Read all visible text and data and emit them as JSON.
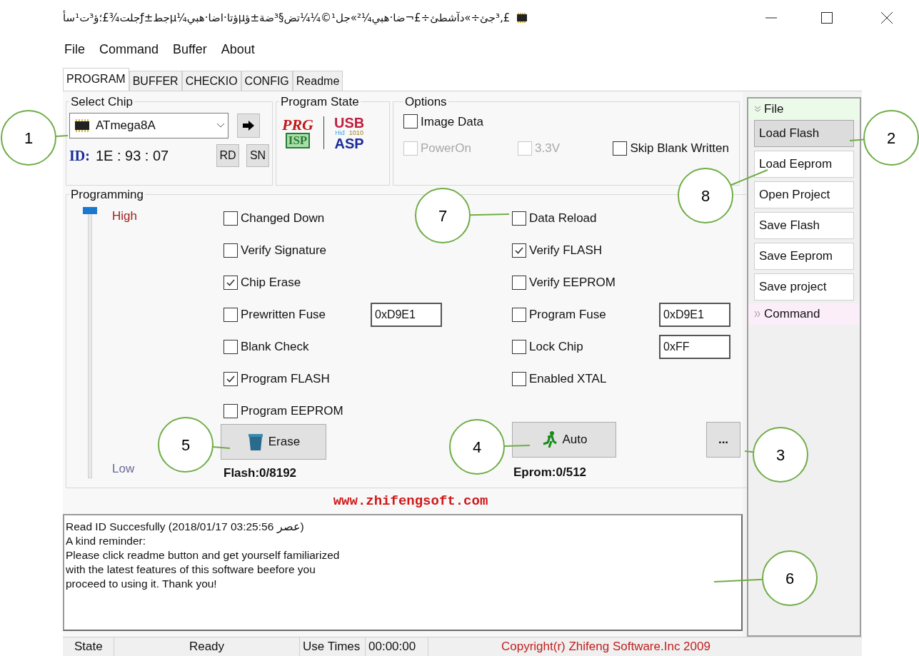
{
  "window": {
    "title": "£‚³جئ÷»دآشطئ÷£¬ضا·هبي¼²»جل¹©¼¼تض§³ضة±ؤµؤتا·اضا·هبي¼µجط±ƒجلت¾£؛ؤ³ت¹سأ"
  },
  "menu": [
    "File",
    "Command",
    "Buffer",
    "About"
  ],
  "tabs": [
    {
      "label": "PROGRAM",
      "selected": true
    },
    {
      "label": "BUFFER",
      "selected": false
    },
    {
      "label": "CHECKIO",
      "selected": false
    },
    {
      "label": "CONFIG",
      "selected": false
    },
    {
      "label": "Readme",
      "selected": false
    }
  ],
  "select_chip": {
    "title": "Select Chip",
    "chip": "ATmega8A",
    "id_label": "ID:",
    "id_value": "1E : 93 : 07",
    "buttons": [
      "RD",
      "SN"
    ]
  },
  "program_state": {
    "title": "Program State",
    "prg": "PRG",
    "isp": "ISP",
    "usb": "USB",
    "hid": "Hid",
    "bits": "1010",
    "asp": "ASP"
  },
  "options": {
    "title": "Options",
    "items": [
      {
        "label": "Image Data",
        "checked": false,
        "disabled": false
      },
      {
        "label": "PowerOn",
        "checked": false,
        "disabled": true
      },
      {
        "label": "3.3V",
        "checked": false,
        "disabled": true
      },
      {
        "label": "Skip Blank Written",
        "checked": false,
        "disabled": false
      }
    ]
  },
  "programming": {
    "title": "Programming",
    "speed": {
      "high": "High",
      "low": "Low",
      "level": 1
    },
    "left": [
      {
        "label": "Changed Down",
        "checked": false
      },
      {
        "label": "Verify Signature",
        "checked": false
      },
      {
        "label": "Chip Erase",
        "checked": true
      },
      {
        "label": "Prewritten Fuse",
        "checked": false,
        "value": "0xD9E1"
      },
      {
        "label": "Blank Check",
        "checked": false
      },
      {
        "label": "Program FLASH",
        "checked": true
      },
      {
        "label": "Program EEPROM",
        "checked": false
      }
    ],
    "right": [
      {
        "label": "Data Reload",
        "checked": false
      },
      {
        "label": "Verify FLASH",
        "checked": true
      },
      {
        "label": "Verify EEPROM",
        "checked": false
      },
      {
        "label": "Program Fuse",
        "checked": false,
        "value": "0xD9E1"
      },
      {
        "label": "Lock Chip",
        "checked": false,
        "value": "0xFF"
      },
      {
        "label": "Enabled XTAL",
        "checked": false
      }
    ],
    "erase": "Erase",
    "auto": "Auto",
    "more": "...",
    "flash_count": "Flash:0/8192",
    "eprom_count": "Eprom:0/512"
  },
  "website": "www.zhifengsoft.com",
  "log": [
    "Read ID Succesfully (2018/01/17 03:25:56 عصر)",
    "A kind reminder:",
    "Please click readme button and get yourself familiarized",
    "with the latest features of this software beefore you",
    "proceed to using it. Thank you!"
  ],
  "sidebar": {
    "sections": [
      {
        "title": "File",
        "expanded": true,
        "items": [
          {
            "label": "Load Flash",
            "selected": true
          },
          {
            "label": "Load Eeprom",
            "selected": false
          },
          {
            "label": "Open Project",
            "selected": false
          },
          {
            "label": "Save Flash",
            "selected": false
          },
          {
            "label": "Save Eeprom",
            "selected": false
          },
          {
            "label": "Save project",
            "selected": false
          }
        ]
      },
      {
        "title": "Command",
        "expanded": false
      }
    ]
  },
  "status_bar": {
    "state_label": "State",
    "state": "Ready",
    "time_label": "Use Times",
    "time": "00:00:00",
    "copyright": "Copyright(r) Zhifeng Software.Inc 2009"
  },
  "callouts": [
    "1",
    "2",
    "3",
    "4",
    "5",
    "6",
    "7",
    "8"
  ]
}
